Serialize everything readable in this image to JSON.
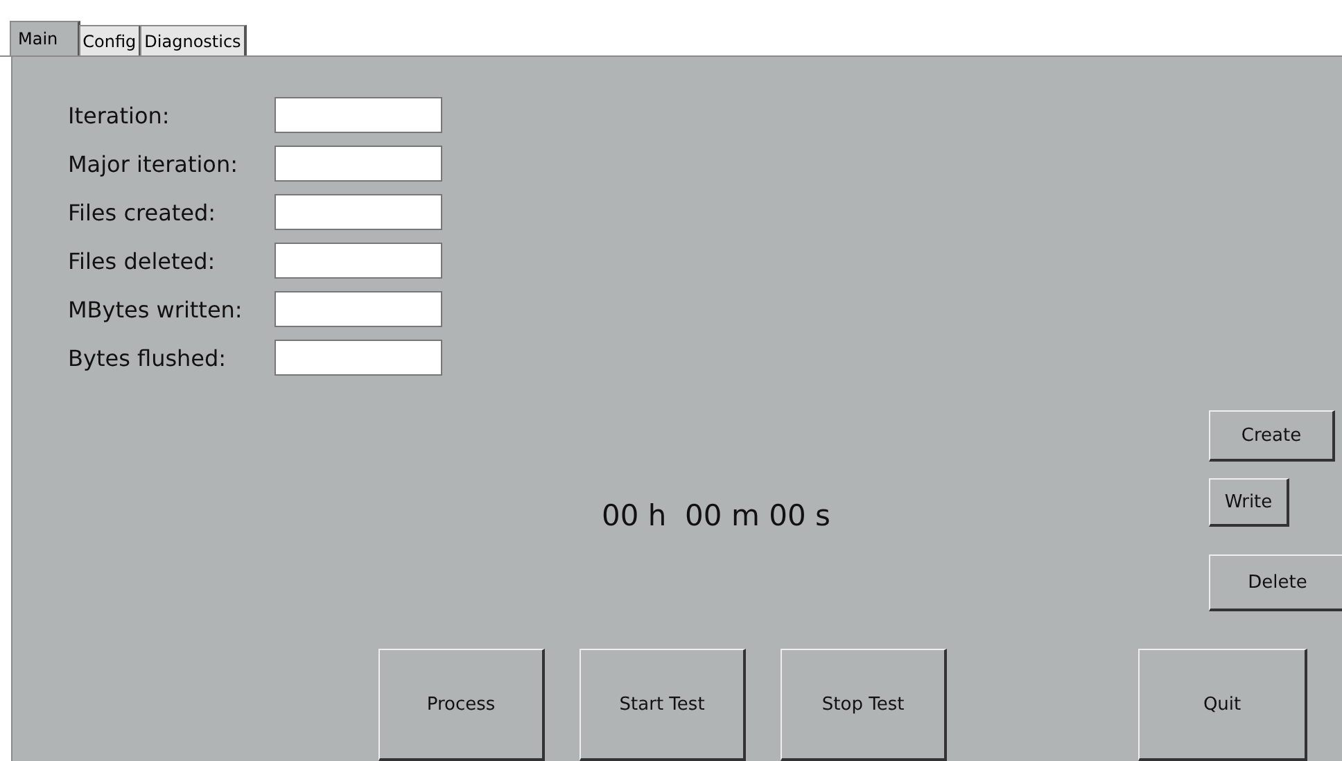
{
  "tabs": [
    {
      "label": "Main",
      "selected": true
    },
    {
      "label": "Config",
      "selected": false
    },
    {
      "label": "Diagnostics",
      "selected": false
    }
  ],
  "fields": [
    {
      "label": "Iteration:"
    },
    {
      "label": "Major iteration:"
    },
    {
      "label": "Files created:"
    },
    {
      "label": "Files deleted:"
    },
    {
      "label": "MBytes written:"
    },
    {
      "label": "Bytes flushed:"
    }
  ],
  "side_buttons": [
    "Create",
    "Write",
    "Delete"
  ],
  "timer": "00 h  00 m 00 s",
  "bottom_buttons": [
    "Process",
    "Start Test",
    "Stop Test",
    "Quit"
  ]
}
